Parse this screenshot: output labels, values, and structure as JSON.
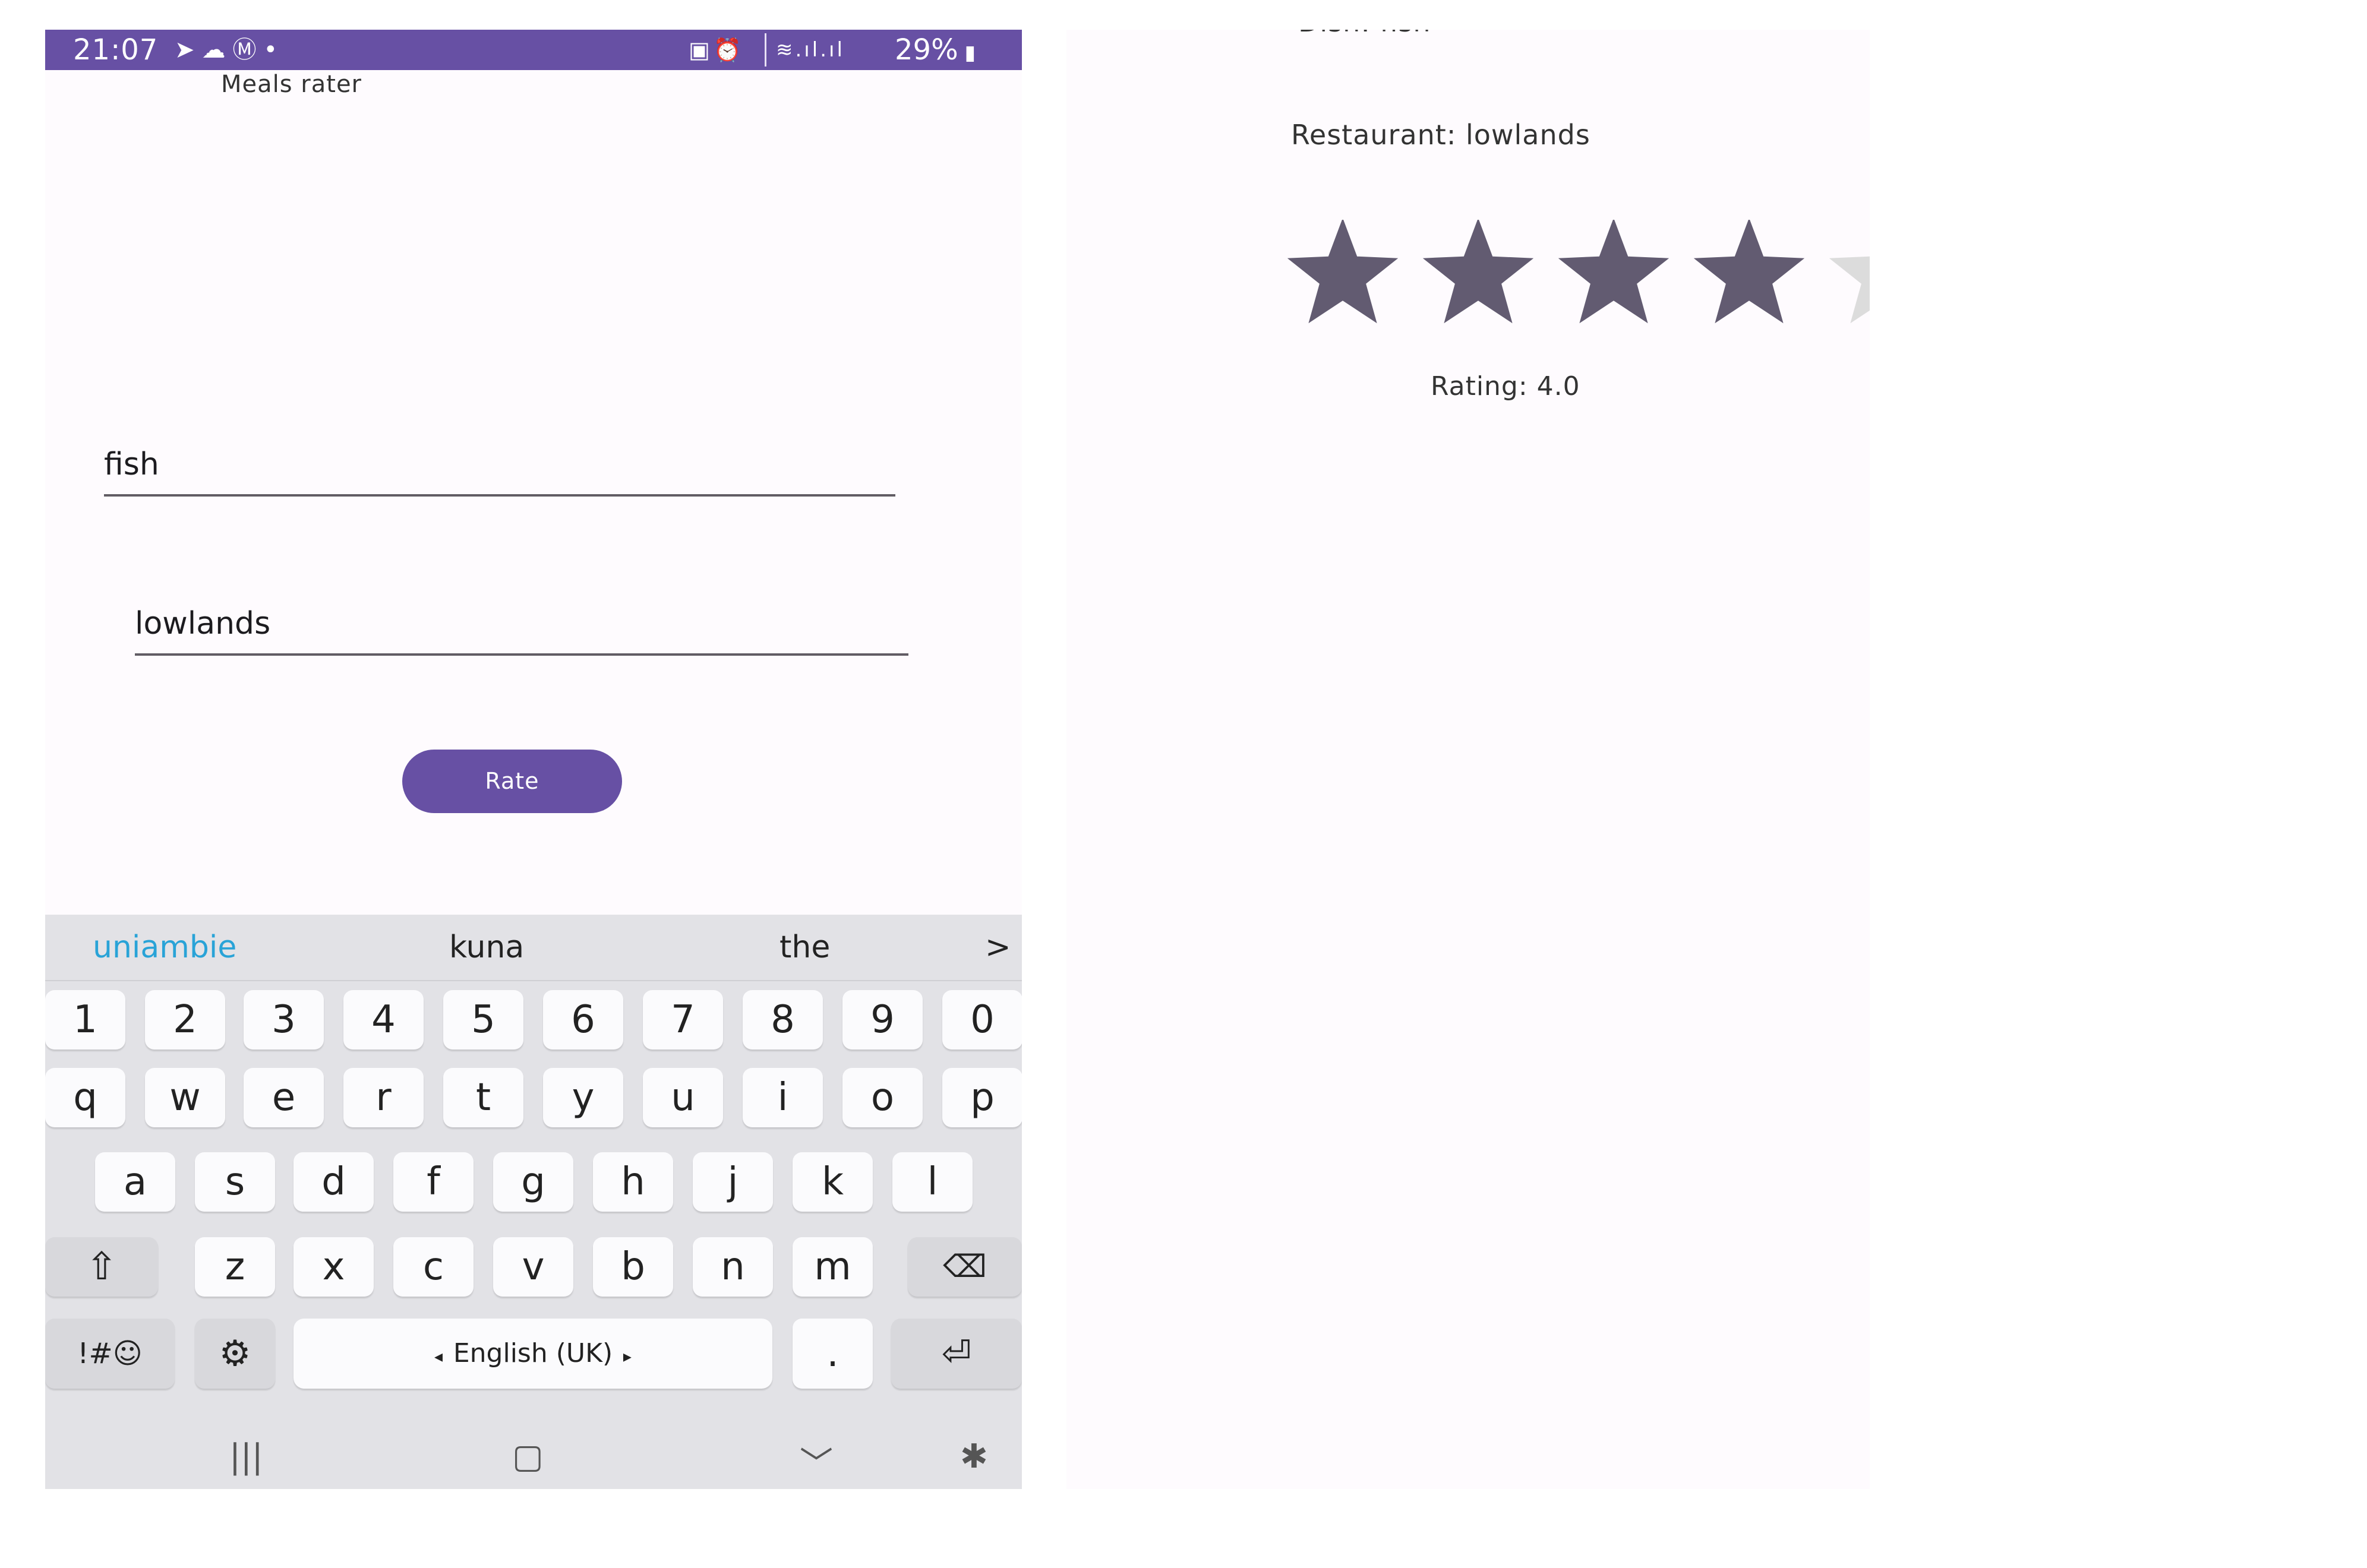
{
  "status_bar": {
    "time": "21:07",
    "left_icons": [
      "telegram-icon",
      "cloud-icon",
      "tm-icon",
      "dot-icon"
    ],
    "right_icons": [
      "lock-screen-icon",
      "alarm-icon",
      "wifi-icon",
      "signal-icon",
      "signal-icon"
    ],
    "battery": "29%",
    "background": "#6750a4"
  },
  "rater_screen": {
    "title": "Meals rater",
    "dish_value": "fish",
    "restaurant_value": "lowlands",
    "rate_button": "Rate",
    "accent": "#6750a4"
  },
  "keyboard": {
    "suggestions": [
      "uniambie",
      "kuna",
      "the"
    ],
    "more": ">",
    "number_row": [
      "1",
      "2",
      "3",
      "4",
      "5",
      "6",
      "7",
      "8",
      "9",
      "0"
    ],
    "row1": [
      "q",
      "w",
      "e",
      "r",
      "t",
      "y",
      "u",
      "i",
      "o",
      "p"
    ],
    "row2": [
      "a",
      "s",
      "d",
      "f",
      "g",
      "h",
      "j",
      "k",
      "l"
    ],
    "row3": [
      "z",
      "x",
      "c",
      "v",
      "b",
      "n",
      "m"
    ],
    "symbols_key": "!#☺",
    "space_label": "English (UK)",
    "period_key": "."
  },
  "result_screen": {
    "dish": "Dish: fish",
    "restaurant": "Restaurant: lowlands",
    "rating_text": "Rating: 4.0",
    "rating_value": 4.0,
    "rating_max": 5,
    "star_filled_color": "#625b71",
    "star_empty_color": "#dcdcdc"
  }
}
